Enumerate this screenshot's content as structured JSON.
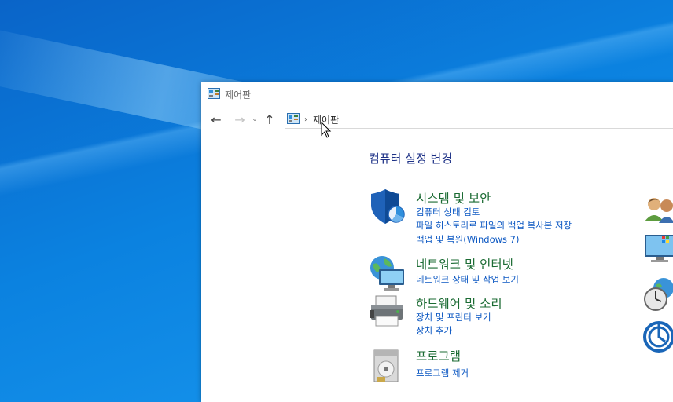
{
  "window": {
    "title": "제어판"
  },
  "address": {
    "crumb": "제어판"
  },
  "main": {
    "heading": "컴퓨터 설정 변경",
    "categories": [
      {
        "title": "시스템 및 보안",
        "links": [
          "컴퓨터 상태 검토",
          "파일 히스토리로 파일의 백업 복사본 저장",
          "백업 및 복원(Windows 7)"
        ]
      },
      {
        "title": "네트워크 및 인터넷",
        "links": [
          "네트워크 상태 및 작업 보기"
        ]
      },
      {
        "title": "하드웨어 및 소리",
        "links": [
          "장치 및 프린터 보기",
          "장치 추가"
        ]
      },
      {
        "title": "프로그램",
        "links": [
          "프로그램 제거"
        ]
      }
    ]
  },
  "icons": {
    "back": "back-arrow-icon",
    "forward": "forward-arrow-icon",
    "recent": "recent-locations-chevron-icon",
    "up": "up-arrow-icon"
  },
  "colors": {
    "heading": "#1e3287",
    "category_title": "#1b6b33",
    "link": "#0b57c2",
    "desktop": "#0a78d7"
  }
}
